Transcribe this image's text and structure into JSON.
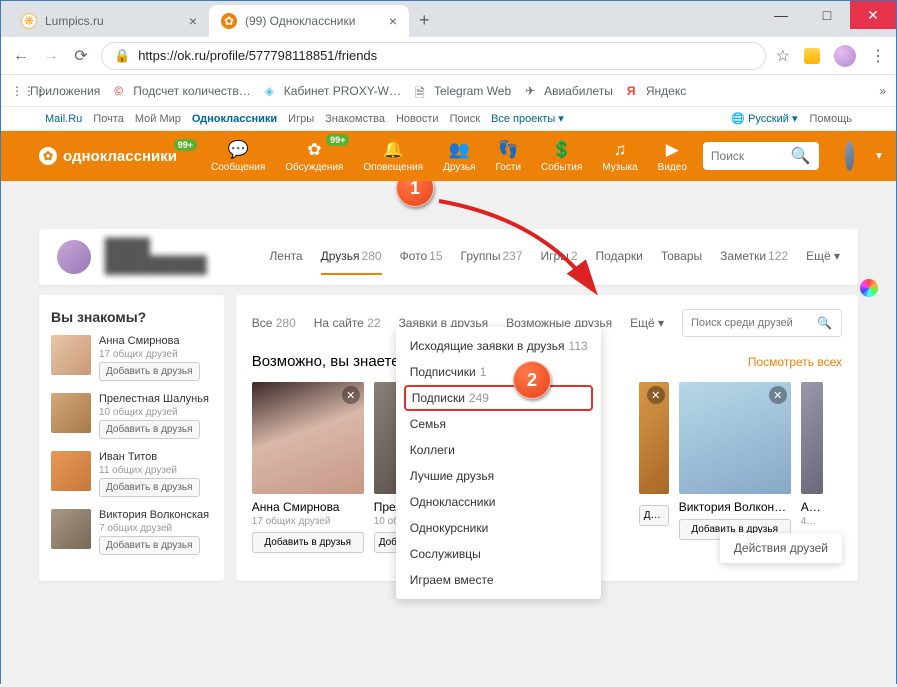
{
  "window": {
    "minimize": "—",
    "maximize": "□",
    "close": "✕"
  },
  "tabs": [
    {
      "title": "Lumpics.ru",
      "favicon_color": "#ffa726"
    },
    {
      "title": "(99) Одноклассники",
      "favicon_color": "#ee8208",
      "active": true
    }
  ],
  "addressbar": {
    "url": "https://ok.ru/profile/577798118851/friends",
    "bookmarks": [
      {
        "icon": "⋮⋮⋮",
        "label": "Приложения"
      },
      {
        "icon": "©",
        "label": "Подсчет количеств…",
        "icon_color": "#e53935"
      },
      {
        "icon": "◇",
        "label": "Кабинет PROXY-W…",
        "icon_color": "#4fc3f7"
      },
      {
        "icon": "🗎",
        "label": "Telegram Web"
      },
      {
        "icon": "✈",
        "label": "Авиабилеты"
      },
      {
        "icon": "Я",
        "label": "Яндекс",
        "icon_color": "#f44336"
      }
    ]
  },
  "portal": {
    "links": [
      "Mail.Ru",
      "Почта",
      "Мой Мир",
      "Одноклассники",
      "Игры",
      "Знакомства",
      "Новости",
      "Поиск",
      "Все проекты ▾"
    ],
    "active_index": 3,
    "lang": "Русский ▾",
    "help": "Помощь"
  },
  "oknav": {
    "logo": "одноклассники",
    "logo_badge": "99+",
    "items": [
      {
        "icon": "💬",
        "label": "Сообщения"
      },
      {
        "icon": "✿",
        "label": "Обсуждения",
        "badge": "99+"
      },
      {
        "icon": "🔔",
        "label": "Оповещения"
      },
      {
        "icon": "👥",
        "label": "Друзья"
      },
      {
        "icon": "👣",
        "label": "Гости"
      },
      {
        "icon": "$",
        "label": "События"
      },
      {
        "icon": "♫",
        "label": "Музыка"
      },
      {
        "icon": "▶",
        "label": "Видео"
      }
    ],
    "search_placeholder": "Поиск"
  },
  "profile": {
    "name": "████ █████████"
  },
  "ptabs": [
    {
      "label": "Лента"
    },
    {
      "label": "Друзья",
      "count": "280",
      "active": true
    },
    {
      "label": "Фото",
      "count": "15"
    },
    {
      "label": "Группы",
      "count": "237"
    },
    {
      "label": "Игры",
      "count": "2"
    },
    {
      "label": "Подарки"
    },
    {
      "label": "Товары"
    },
    {
      "label": "Заметки",
      "count": "122"
    },
    {
      "label": "Ещё ▾"
    }
  ],
  "sidebar": {
    "title": "Вы знакомы?",
    "addLabel": "Добавить в друзья",
    "items": [
      {
        "name": "Анна Смирнова",
        "mutual": "17 общих друзей"
      },
      {
        "name": "Прелестная Шалунья",
        "mutual": "10 общих друзей"
      },
      {
        "name": "Иван Титов",
        "mutual": "11 общих друзей"
      },
      {
        "name": "Виктория Волконская",
        "mutual": "7 общих друзей"
      }
    ]
  },
  "filters": [
    {
      "label": "Все",
      "count": "280"
    },
    {
      "label": "На сайте",
      "count": "22"
    },
    {
      "label": "Заявки в друзья"
    },
    {
      "label": "Возможные друзья"
    },
    {
      "label": "Ещё ▾"
    }
  ],
  "friend_search_placeholder": "Поиск среди друзей",
  "section": {
    "title": "Возможно, вы знаете эти",
    "more": "Посмотреть всех"
  },
  "cards": [
    {
      "name": "Анна Смирнова",
      "mutual": "17 общих друзей",
      "btn": "Добавить в друзья"
    },
    {
      "name": "Прел…",
      "mutual": "10 общ…",
      "btn": "Добавить в друзья"
    },
    {
      "name": "",
      "mutual": "",
      "btn": "Добавить в друзья"
    },
    {
      "name": "Виктория Волконская",
      "mutual": "",
      "btn": "Добавить в друзья"
    },
    {
      "name": "А…",
      "mutual": "4…",
      "btn": ""
    }
  ],
  "dropdown": [
    {
      "label": "Исходящие заявки в друзья",
      "count": "113"
    },
    {
      "label": "Подписчики",
      "count": "1"
    },
    {
      "label": "Подписки",
      "count": "249",
      "hi": true
    },
    {
      "label": "Семья"
    },
    {
      "label": "Коллеги"
    },
    {
      "label": "Лучшие друзья"
    },
    {
      "label": "Одноклассники"
    },
    {
      "label": "Однокурсники"
    },
    {
      "label": "Сослуживцы"
    },
    {
      "label": "Играем вместе"
    }
  ],
  "actions_popup": "Действия друзей",
  "callouts": {
    "one": "1",
    "two": "2"
  }
}
